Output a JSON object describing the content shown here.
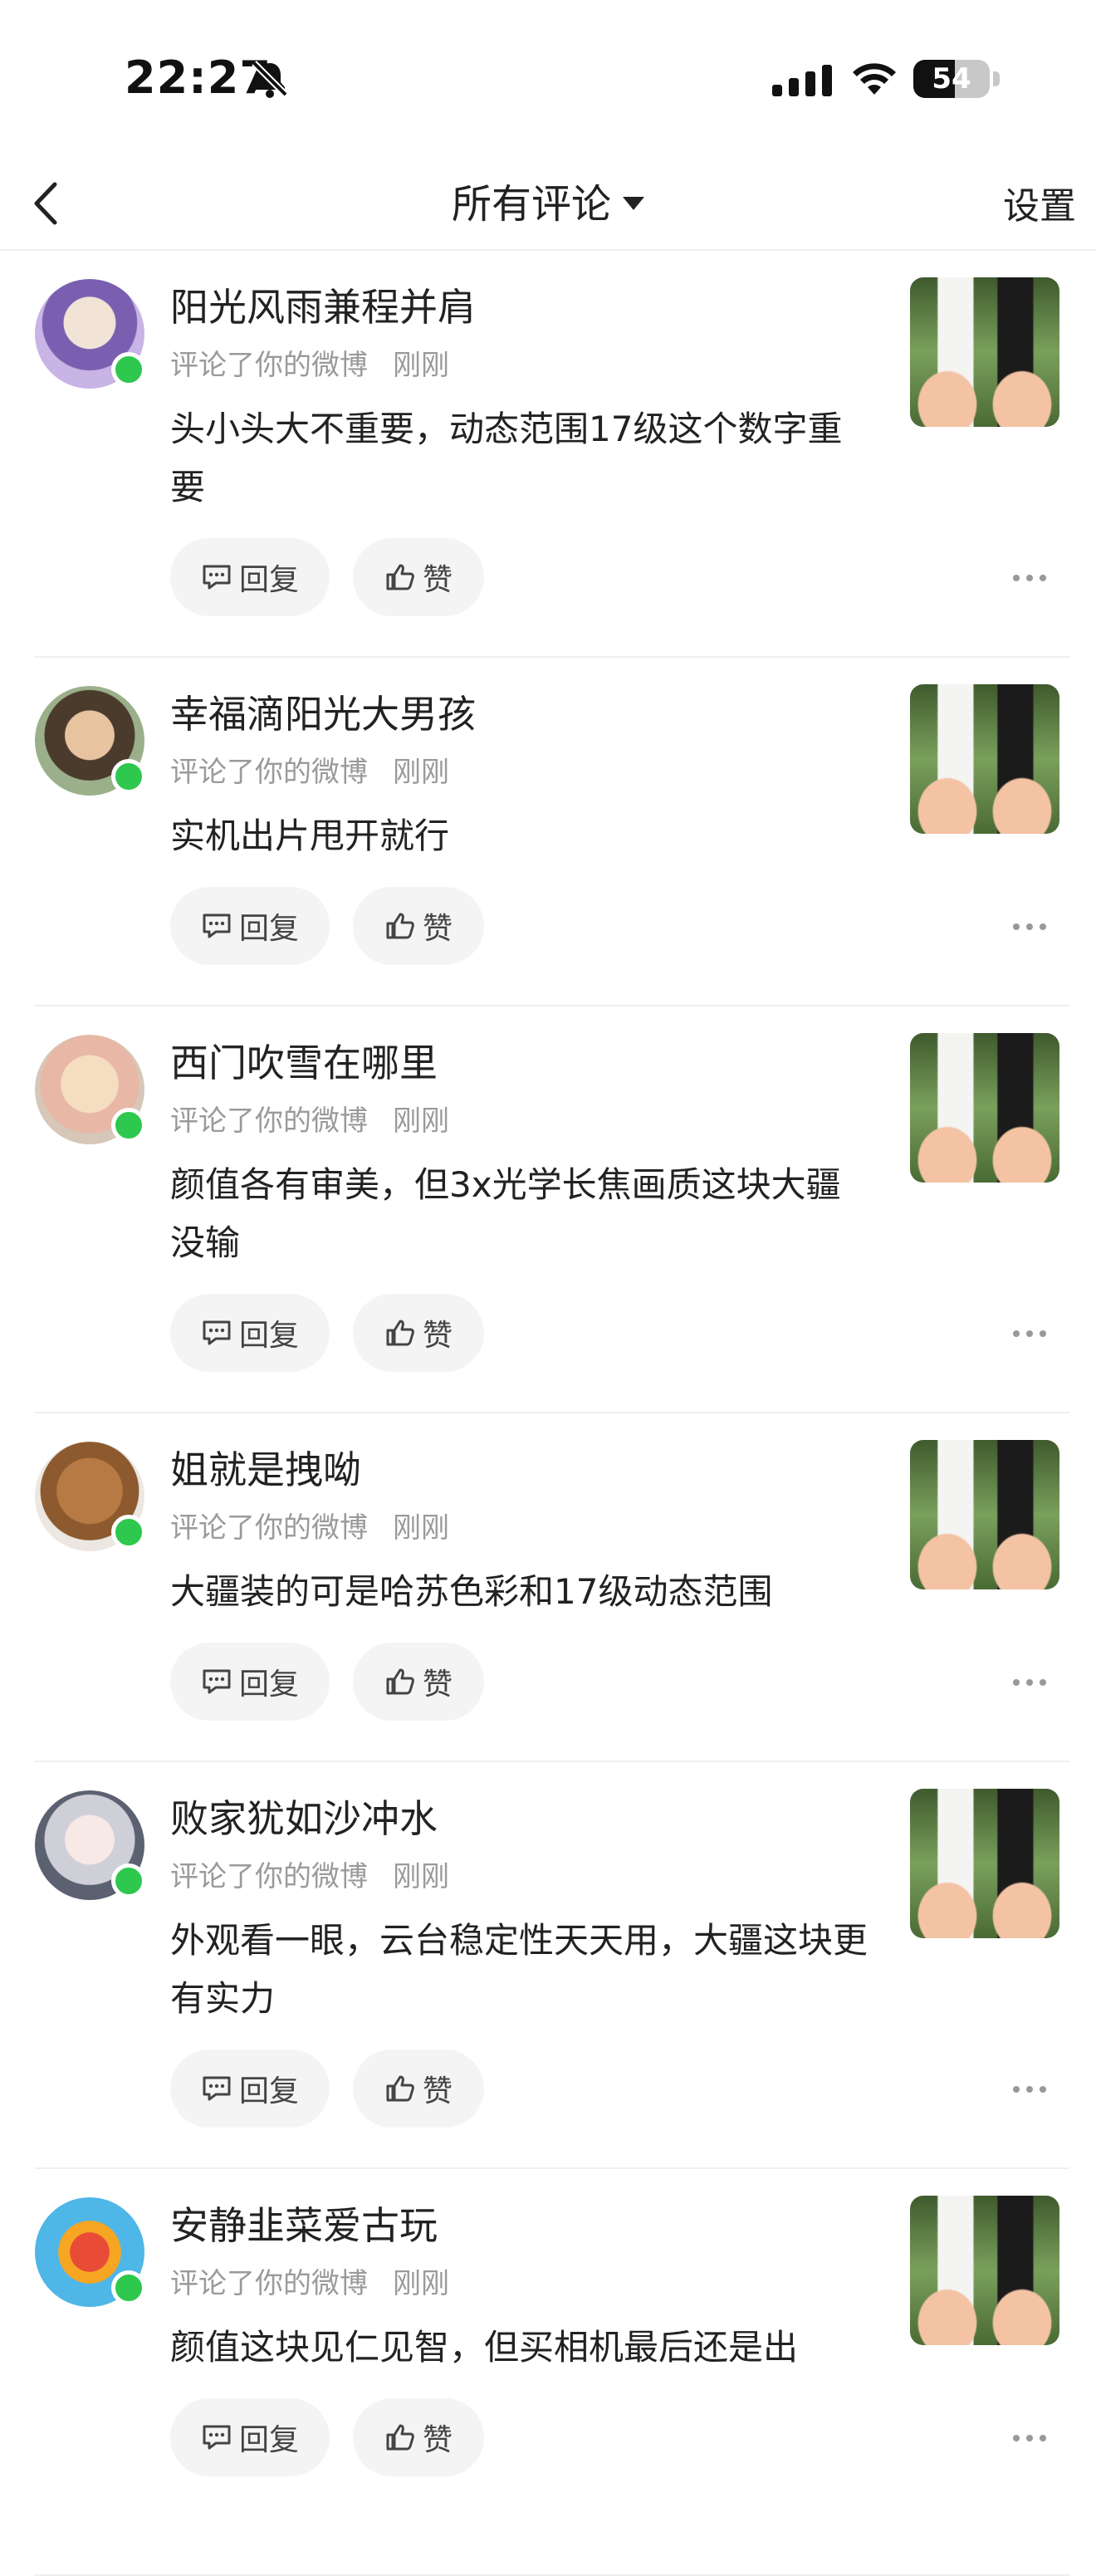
{
  "status_bar": {
    "time": "22:27",
    "battery": "54",
    "battery_level": 0.54,
    "icons": [
      "bell-slash-icon",
      "cellular-signal-icon",
      "wifi-icon",
      "battery-icon"
    ]
  },
  "nav": {
    "back_icon": "chevron-left-icon",
    "title": "所有评论",
    "dropdown_icon": "caret-down-icon",
    "settings_label": "设置"
  },
  "comments": [
    {
      "name": "阳光风雨兼程并肩",
      "action": "评论了你的微博",
      "time": "刚刚",
      "text": "头小头大不重要，动态范围17级这个数字重要",
      "reply": "回复",
      "like": "赞"
    },
    {
      "name": "幸福滴阳光大男孩",
      "action": "评论了你的微博",
      "time": "刚刚",
      "text": "实机出片甩开就行",
      "reply": "回复",
      "like": "赞"
    },
    {
      "name": "西门吹雪在哪里",
      "action": "评论了你的微博",
      "time": "刚刚",
      "text": "颜值各有审美，但3x光学长焦画质这块大疆没输",
      "reply": "回复",
      "like": "赞"
    },
    {
      "name": "姐就是拽呦",
      "action": "评论了你的微博",
      "time": "刚刚",
      "text": "大疆装的可是哈苏色彩和17级动态范围",
      "reply": "回复",
      "like": "赞"
    },
    {
      "name": "败家犹如沙冲水",
      "action": "评论了你的微博",
      "time": "刚刚",
      "text": "外观看一眼，云台稳定性天天用，大疆这块更有实力",
      "reply": "回复",
      "like": "赞"
    },
    {
      "name": "安静韭菜爱古玩",
      "action": "评论了你的微博",
      "time": "刚刚",
      "text": "颜值这块见仁见智，但买相机最后还是出",
      "reply": "回复",
      "like": "赞"
    }
  ],
  "colors": {
    "online": "#2dc84d",
    "button_bg": "#f4f4f4",
    "meta_text": "#9a9a9a"
  }
}
